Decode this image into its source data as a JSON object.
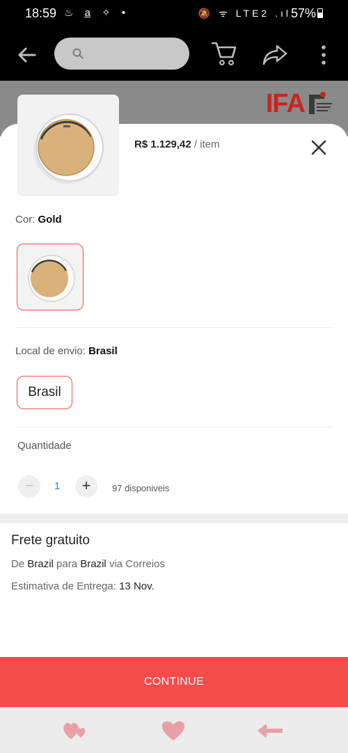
{
  "status_bar": {
    "time": "18:59",
    "left_icons": "♨ a̲ ✧ •",
    "right_icons": "🔕 ᯤ LTE2 .ıl",
    "battery": "57%"
  },
  "app_bar": {
    "search_placeholder": ""
  },
  "backdrop": {
    "logo_text": "IFA"
  },
  "product": {
    "price": "R$ 1.129,42",
    "unit": "/ item"
  },
  "color": {
    "label": "Cor:",
    "value": "Gold"
  },
  "shipping_origin": {
    "label": "Local de envio:",
    "value": "Brasil",
    "option": "Brasil"
  },
  "quantity": {
    "label": "Quantidade",
    "minus": "−",
    "value": "1",
    "plus": "+",
    "available": "97 disponiveis"
  },
  "shipping": {
    "title": "Frete gratuito",
    "route_prefix": "De",
    "from": "Brazil",
    "route_mid": "para",
    "to": "Brazil",
    "carrier": "via Correios",
    "estimate_label": "Estimativa de Entrega:",
    "estimate_value": "13 Nov."
  },
  "actions": {
    "continue": "CONTINUE"
  },
  "colors": {
    "accent": "#f44b4b",
    "selected_border": "#e5534b",
    "product_gold": "#d8b27a",
    "nav_pink": "#e8a0a8"
  }
}
